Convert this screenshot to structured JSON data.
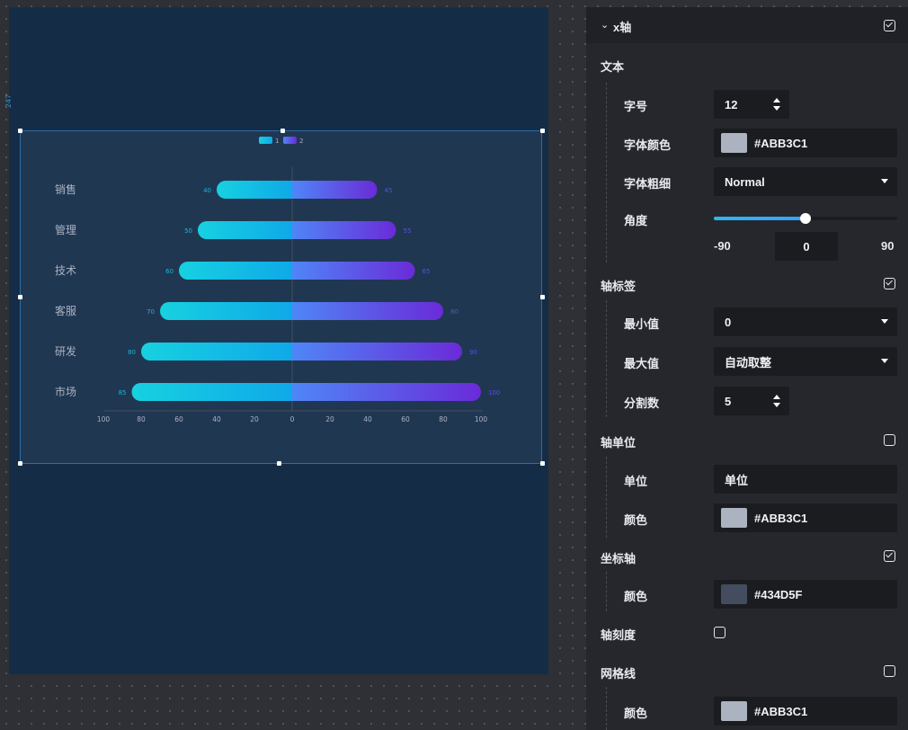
{
  "canvas": {
    "ruler_mark": "247"
  },
  "chart_data": {
    "type": "bar",
    "subtype": "diverging-horizontal",
    "legend": [
      "1",
      "2"
    ],
    "legend_placement": "top-center",
    "categories": [
      "销售",
      "管理",
      "技术",
      "客服",
      "研发",
      "市场"
    ],
    "series": [
      {
        "name": "1",
        "values": [
          40,
          50,
          60,
          70,
          80,
          85
        ],
        "color_start": "#17d1e0",
        "color_end": "#0fa9e8"
      },
      {
        "name": "2",
        "values": [
          45,
          55,
          65,
          80,
          90,
          100
        ],
        "color_start": "#4f86f7",
        "color_end": "#6a2bd8"
      }
    ],
    "x_ticks": [
      "100",
      "80",
      "60",
      "40",
      "20",
      "0",
      "20",
      "40",
      "60",
      "80",
      "100"
    ],
    "xlim": [
      -100,
      100
    ],
    "grid": false,
    "colors": {
      "label": "#abb3c1",
      "value_label_left": "#16b7d8",
      "value_label_right": "#5b4fe0",
      "axis": "#434d5f"
    }
  },
  "panel": {
    "header": {
      "title": "x轴",
      "checked": true
    },
    "text_section": {
      "title": "文本",
      "font_size_label": "字号",
      "font_size_value": "12",
      "font_color_label": "字体颜色",
      "font_color_value": "#ABB3C1",
      "font_color_hex": "#abb3c1",
      "font_weight_label": "字体粗细",
      "font_weight_value": "Normal",
      "angle_label": "角度",
      "angle_min": "-90",
      "angle_value": "0",
      "angle_max": "90",
      "angle_fraction": 0.5
    },
    "axis_label_section": {
      "title": "轴标签",
      "checked": true,
      "min_label": "最小值",
      "min_value": "0",
      "max_label": "最大值",
      "max_value": "自动取整",
      "split_label": "分割数",
      "split_value": "5"
    },
    "axis_unit_section": {
      "title": "轴单位",
      "checked": false,
      "unit_label": "单位",
      "unit_value": "单位",
      "color_label": "颜色",
      "color_value": "#ABB3C1",
      "color_hex": "#abb3c1"
    },
    "axis_line_section": {
      "title": "坐标轴",
      "checked": true,
      "color_label": "颜色",
      "color_value": "#434D5F",
      "color_hex": "#434d5f"
    },
    "axis_tick_section": {
      "title": "轴刻度",
      "checked": false
    },
    "grid_section": {
      "title": "网格线",
      "checked": false,
      "color_label": "颜色",
      "color_value": "#ABB3C1",
      "color_hex": "#abb3c1"
    }
  }
}
